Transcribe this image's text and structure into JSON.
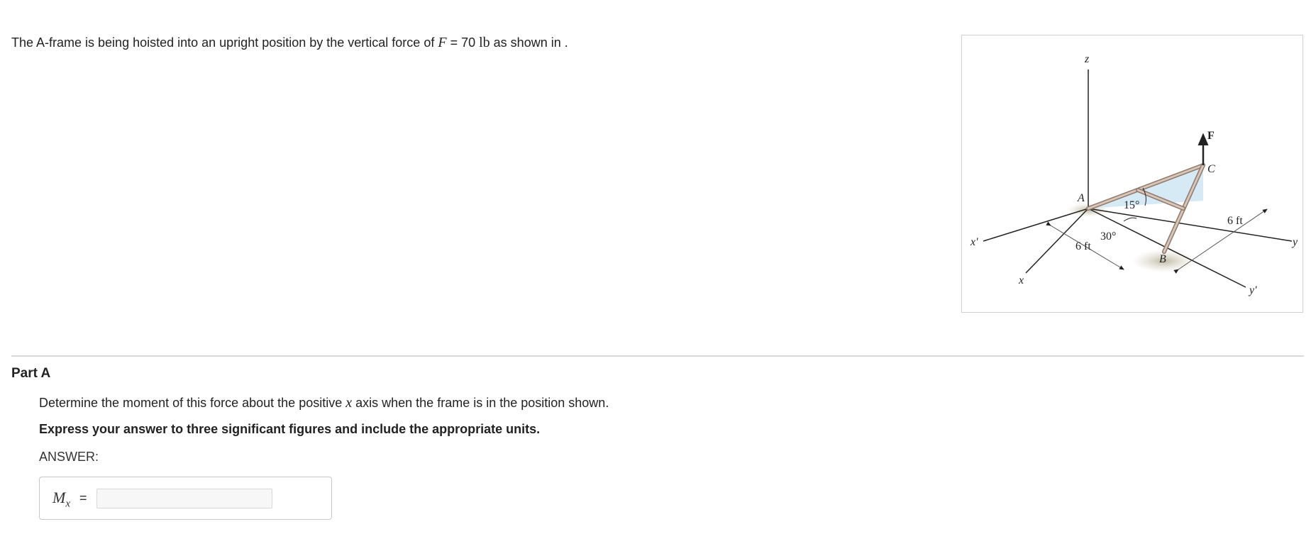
{
  "problem": {
    "text_before": "The A-frame is being hoisted into an upright position by the vertical force of ",
    "force_symbol": "F",
    "equals": " = 70 ",
    "unit": "lb",
    "text_after": " as shown in ."
  },
  "figure": {
    "labels": {
      "z": "z",
      "x": "x",
      "x_prime": "x′",
      "y": "y",
      "y_prime": "y′",
      "A": "A",
      "B": "B",
      "C": "C",
      "F": "F",
      "angle_15": "15°",
      "angle_30": "30°",
      "dim_6ft_left": "6 ft",
      "dim_6ft_right": "6 ft"
    }
  },
  "part": {
    "title": "Part A",
    "question_before": "Determine the moment of this force about the positive ",
    "question_var": "x",
    "question_after": " axis when the frame is in the position shown.",
    "instruction": "Express your answer to three significant figures and include the appropriate units.",
    "answer_label": "ANSWER:",
    "answer_var": "M",
    "answer_sub": "x",
    "answer_eq": "=",
    "answer_value": ""
  }
}
